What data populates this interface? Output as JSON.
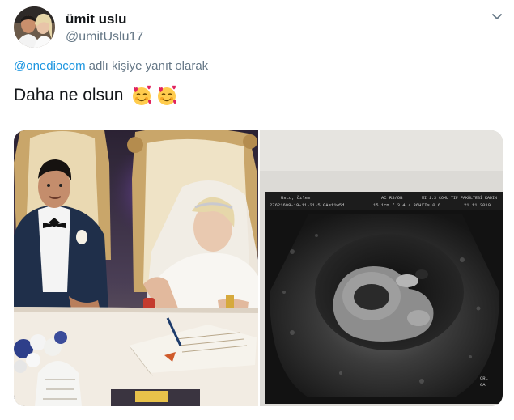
{
  "author": {
    "name": "ümit uslu",
    "handle": "@umitUslu17"
  },
  "reply": {
    "mention": "@onediocom",
    "text": "adlı kişiye yanıt olarak"
  },
  "tweet": {
    "text": "Daha ne olsun",
    "emojis": [
      "smiling-face-with-hearts-icon",
      "smiling-face-with-hearts-icon"
    ]
  },
  "media": {
    "photos": [
      "wedding-photo",
      "ultrasound-photo"
    ],
    "ultrasound_header": {
      "left_line1": "UsLu, Özlem",
      "left_line2": "27621609-19-11-21-5   GA=11w5d",
      "center_line1": "AC RS/OB",
      "center_line2": "15.1cm / 3.4 / 36Hz",
      "right_line1": "MI 1.3   ÇOMU TIP FAKÜLTESİ KADIN",
      "right_line2": "TIs 0.6",
      "date": "21.11.2019"
    },
    "ultrasound_corner_lines": [
      "CRL",
      "GA"
    ]
  }
}
